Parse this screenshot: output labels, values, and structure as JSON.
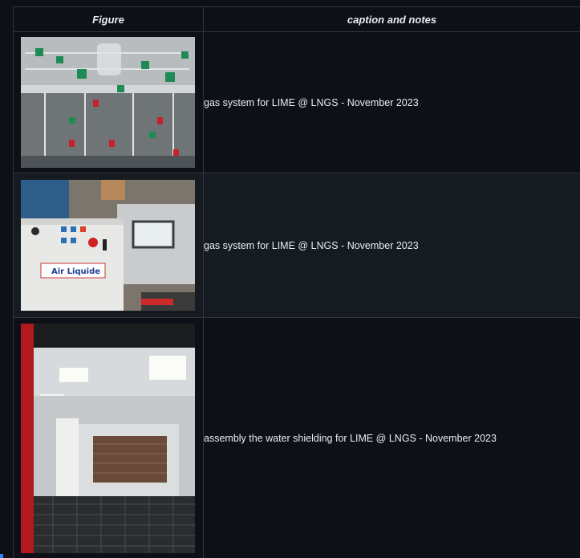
{
  "table": {
    "headers": [
      "Figure",
      "caption and notes"
    ],
    "rows": [
      {
        "caption": "gas system for LIME @ LNGS - November 2023"
      },
      {
        "caption": "gas system for LIME @ LNGS - November 2023"
      },
      {
        "caption": "assembly the water shielding for LIME @ LNGS - November 2023"
      }
    ],
    "photo_labels": {
      "airliquide": "Air Liquide"
    }
  },
  "colors": {
    "background": "#0d1117",
    "border": "#30363d",
    "text": "#e6edf3",
    "alt_row": "#161b22"
  }
}
